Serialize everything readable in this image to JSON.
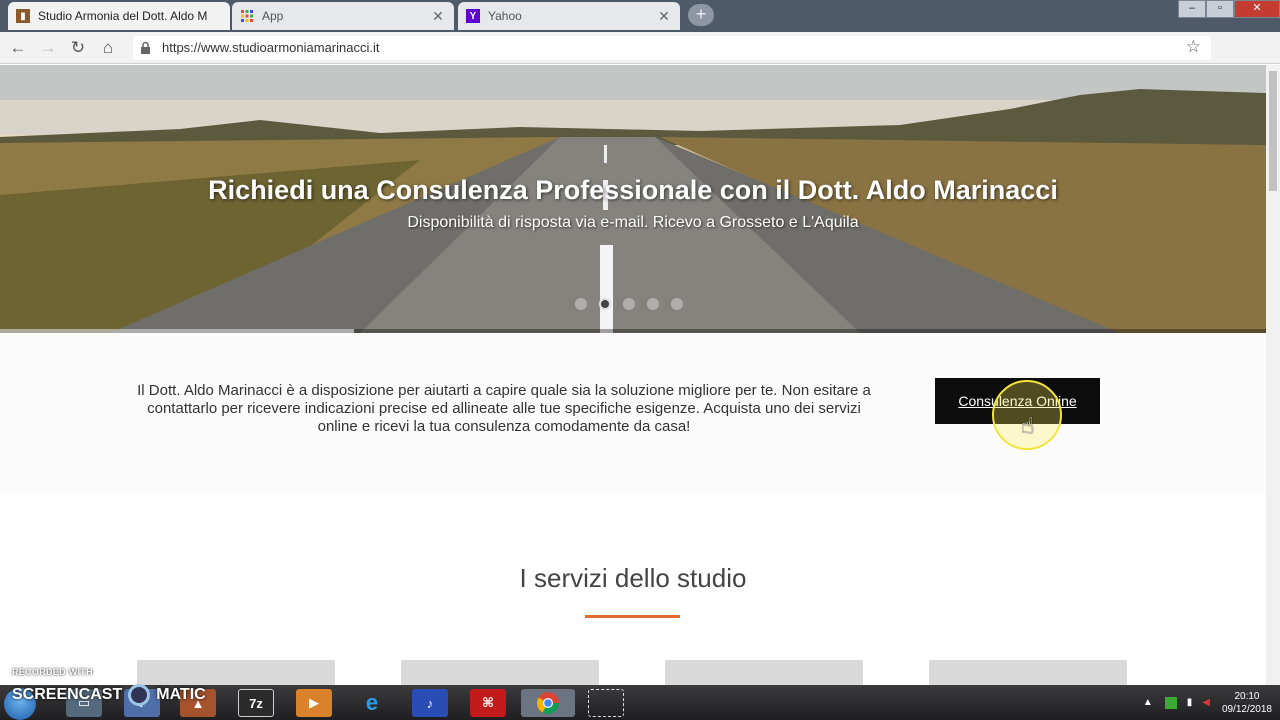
{
  "browser": {
    "tabs": [
      {
        "title": "Studio Armonia del Dott. Aldo M",
        "active": true,
        "favicon": "studio-favicon"
      },
      {
        "title": "App",
        "active": false,
        "favicon": "apps-grid-icon"
      },
      {
        "title": "Yahoo",
        "active": false,
        "favicon": "yahoo-icon"
      }
    ],
    "url": "https://www.studioarmoniamarinacci.it"
  },
  "hero": {
    "title": "Richiedi una Consulenza Professionale con il Dott. Aldo Marinacci",
    "subtitle": "Disponibilità di risposta via e-mail. Ricevo a Grosseto e L'Aquila",
    "slides_total": 5,
    "active_slide_index": 1,
    "slide_progress": 0.28
  },
  "cta": {
    "text": "Il Dott. Aldo Marinacci è a disposizione per aiutarti a capire quale sia la soluzione migliore per te. Non esitare a contattarlo per ricevere indicazioni precise ed allineate alle tue specifiche esigenze. Acquista uno dei servizi online e ricevi la tua consulenza comodamente da casa!",
    "button_label": "Consulenza Online"
  },
  "services": {
    "title": "I servizi dello studio",
    "accent_color": "#e06b2c",
    "cards_visible": 4
  },
  "taskbar": {
    "watermark_top": "RECORDED WITH",
    "watermark_bottom_left": "SCREENCAST",
    "watermark_bottom_right": "MATIC",
    "apps": [
      "explorer-icon",
      "paint-icon",
      "7zip-icon",
      "media-player-icon",
      "internet-explorer-icon",
      "vlc-icon",
      "acrobat-icon",
      "chrome-icon",
      "snipping-icon"
    ],
    "time": "20:10",
    "date": "09/12/2018"
  }
}
